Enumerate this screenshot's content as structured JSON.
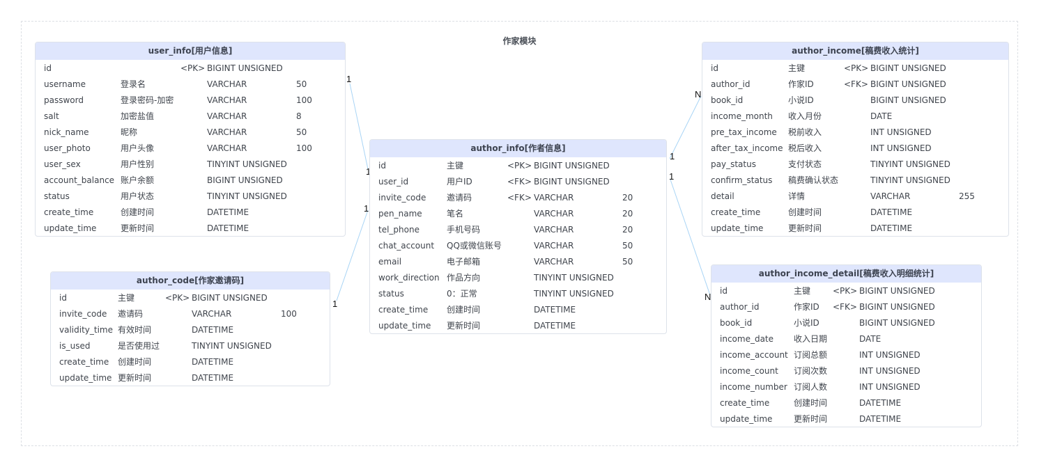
{
  "diagram": {
    "title": "作家模块",
    "colors": {
      "header": "#dfe6fd",
      "border": "#dde2ea",
      "link": "#a8d4f5",
      "group_border": "#dcdfe4"
    },
    "entities": [
      {
        "id": "user_info",
        "title": "user_info[用户信息]",
        "rows": [
          [
            "id",
            "",
            "<PK>",
            "BIGINT UNSIGNED",
            ""
          ],
          [
            "username",
            "登录名",
            "",
            "VARCHAR",
            "50"
          ],
          [
            "password",
            "登录密码-加密",
            "",
            "VARCHAR",
            "100"
          ],
          [
            "salt",
            "加密盐值",
            "",
            "VARCHAR",
            "8"
          ],
          [
            "nick_name",
            "昵称",
            "",
            "VARCHAR",
            "50"
          ],
          [
            "user_photo",
            "用户头像",
            "",
            "VARCHAR",
            "100"
          ],
          [
            "user_sex",
            "用户性别",
            "",
            "TINYINT UNSIGNED",
            ""
          ],
          [
            "account_balance",
            "账户余额",
            "",
            "BIGINT UNSIGNED",
            ""
          ],
          [
            "status",
            "用户状态",
            "",
            "TINYINT UNSIGNED",
            ""
          ],
          [
            "create_time",
            "创建时间",
            "",
            "DATETIME",
            ""
          ],
          [
            "update_time",
            "更新时间",
            "",
            "DATETIME",
            ""
          ]
        ]
      },
      {
        "id": "author_code",
        "title": "author_code[作家邀请码]",
        "rows": [
          [
            "id",
            "主键",
            "<PK>",
            "BIGINT UNSIGNED",
            ""
          ],
          [
            "invite_code",
            "邀请码",
            "",
            "VARCHAR",
            "100"
          ],
          [
            "validity_time",
            "有效时间",
            "",
            "DATETIME",
            ""
          ],
          [
            "is_used",
            "是否使用过",
            "",
            "TINYINT UNSIGNED",
            ""
          ],
          [
            "create_time",
            "创建时间",
            "",
            "DATETIME",
            ""
          ],
          [
            "update_time",
            "更新时间",
            "",
            "DATETIME",
            ""
          ]
        ]
      },
      {
        "id": "author_info",
        "title": "author_info[作者信息]",
        "rows": [
          [
            "id",
            "主键",
            "<PK>",
            "BIGINT UNSIGNED",
            ""
          ],
          [
            "user_id",
            "用户ID",
            "<FK>",
            "BIGINT UNSIGNED",
            ""
          ],
          [
            "invite_code",
            "邀请码",
            "<FK>",
            "VARCHAR",
            "20"
          ],
          [
            "pen_name",
            "笔名",
            "",
            "VARCHAR",
            "20"
          ],
          [
            "tel_phone",
            "手机号码",
            "",
            "VARCHAR",
            "20"
          ],
          [
            "chat_account",
            "QQ或微信账号",
            "",
            "VARCHAR",
            "50"
          ],
          [
            "email",
            "电子邮箱",
            "",
            "VARCHAR",
            "50"
          ],
          [
            "work_direction",
            "作品方向",
            "",
            "TINYINT UNSIGNED",
            ""
          ],
          [
            "status",
            "0：正常",
            "",
            "TINYINT UNSIGNED",
            ""
          ],
          [
            "create_time",
            "创建时间",
            "",
            "DATETIME",
            ""
          ],
          [
            "update_time",
            "更新时间",
            "",
            "DATETIME",
            ""
          ]
        ]
      },
      {
        "id": "author_income",
        "title": "author_income[稿费收入统计]",
        "rows": [
          [
            "id",
            "主键",
            "<PK>",
            "BIGINT UNSIGNED",
            ""
          ],
          [
            "author_id",
            "作家ID",
            "<FK>",
            "BIGINT UNSIGNED",
            ""
          ],
          [
            "book_id",
            "小说ID",
            "",
            "BIGINT UNSIGNED",
            ""
          ],
          [
            "income_month",
            "收入月份",
            "",
            "DATE",
            ""
          ],
          [
            "pre_tax_income",
            "税前收入",
            "",
            "INT UNSIGNED",
            ""
          ],
          [
            "after_tax_income",
            "税后收入",
            "",
            "INT UNSIGNED",
            ""
          ],
          [
            "pay_status",
            "支付状态",
            "",
            "TINYINT UNSIGNED",
            ""
          ],
          [
            "confirm_status",
            "稿费确认状态",
            "",
            "TINYINT UNSIGNED",
            ""
          ],
          [
            "detail",
            "详情",
            "",
            "VARCHAR",
            "255"
          ],
          [
            "create_time",
            "创建时间",
            "",
            "DATETIME",
            ""
          ],
          [
            "update_time",
            "更新时间",
            "",
            "DATETIME",
            ""
          ]
        ]
      },
      {
        "id": "author_income_detail",
        "title": "author_income_detail[稿费收入明细统计]",
        "rows": [
          [
            "id",
            "主键",
            "<PK>",
            "BIGINT UNSIGNED",
            ""
          ],
          [
            "author_id",
            "作家ID",
            "<FK>",
            "BIGINT UNSIGNED",
            ""
          ],
          [
            "book_id",
            "小说ID",
            "",
            "BIGINT UNSIGNED",
            ""
          ],
          [
            "income_date",
            "收入日期",
            "",
            "DATE",
            ""
          ],
          [
            "income_account",
            "订阅总额",
            "",
            "INT UNSIGNED",
            ""
          ],
          [
            "income_count",
            "订阅次数",
            "",
            "INT UNSIGNED",
            ""
          ],
          [
            "income_number",
            "订阅人数",
            "",
            "INT UNSIGNED",
            ""
          ],
          [
            "create_time",
            "创建时间",
            "",
            "DATETIME",
            ""
          ],
          [
            "update_time",
            "更新时间",
            "",
            "DATETIME",
            ""
          ]
        ]
      }
    ],
    "relationships": [
      {
        "from": "user_info",
        "to": "author_info",
        "from_card": "1",
        "to_card": "1"
      },
      {
        "from": "author_code",
        "to": "author_info",
        "from_card": "1",
        "to_card": "1"
      },
      {
        "from": "author_info",
        "to": "author_income",
        "from_card": "1",
        "to_card": "N"
      },
      {
        "from": "author_info",
        "to": "author_income_detail",
        "from_card": "1",
        "to_card": "N"
      }
    ]
  }
}
